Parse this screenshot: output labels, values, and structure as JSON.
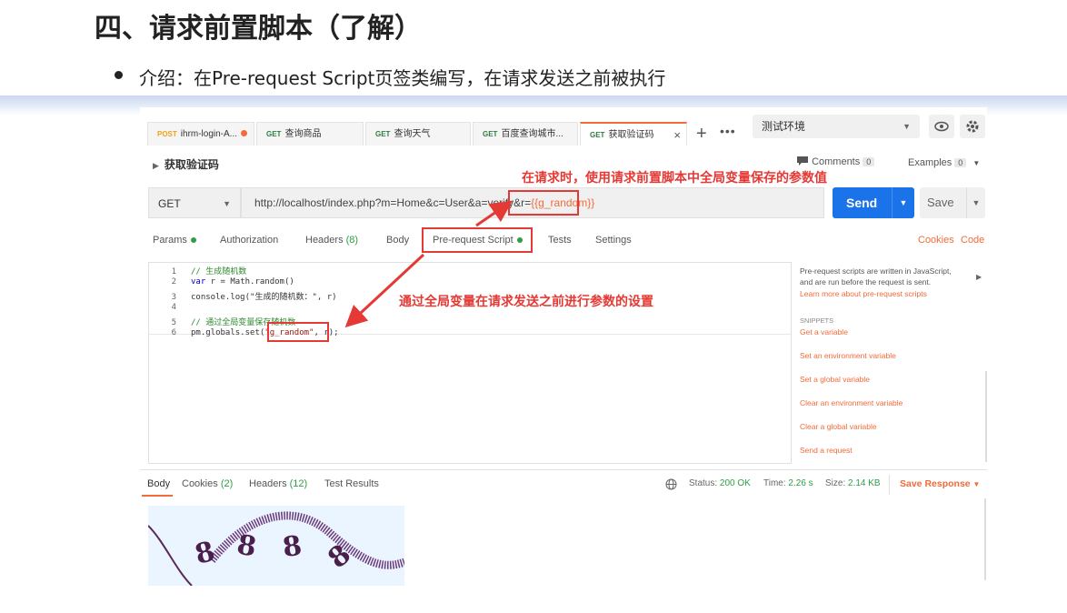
{
  "slide": {
    "title": "四、请求前置脚本（了解）",
    "bullet": "介绍：在Pre-request Script页签类编写，在请求发送之前被执行"
  },
  "tabs": [
    {
      "method": "POST",
      "label": "ihrm-login-A..."
    },
    {
      "method": "GET",
      "label": "查询商品"
    },
    {
      "method": "GET",
      "label": "查询天气"
    },
    {
      "method": "GET",
      "label": "百度查询城市..."
    },
    {
      "method": "GET",
      "label": "获取验证码"
    }
  ],
  "tab_close": "×",
  "tab_add": "+",
  "tab_more": "•••",
  "environment": {
    "selected": "测试环境"
  },
  "request": {
    "name": "获取验证码",
    "method": "GET",
    "url_prefix": "http://localhost/index.php?m=Home&c=User&a=verify&r=",
    "url_var": "{{g_random}}",
    "send_label": "Send",
    "save_label": "Save"
  },
  "comments": {
    "label": "Comments",
    "count": "0"
  },
  "examples": {
    "label": "Examples",
    "count": "0"
  },
  "request_tabs": {
    "params": "Params",
    "authorization": "Authorization",
    "headers": "Headers",
    "headers_count": "(8)",
    "body": "Body",
    "prerequest": "Pre-request Script",
    "tests": "Tests",
    "settings": "Settings",
    "cookies": "Cookies",
    "code": "Code"
  },
  "code_lines": [
    {
      "n": "1",
      "text": "// 生成随机数"
    },
    {
      "n": "2",
      "kw": "var",
      "text": " r = Math.random()"
    },
    {
      "n": "3",
      "text": "console.log(\"生成的随机数：\", r)"
    },
    {
      "n": "4",
      "text": ""
    },
    {
      "n": "5",
      "text": "// 通过全局变量保存随机数"
    },
    {
      "n": "6",
      "pre": "pm.globals.set(",
      "str": "\"g_random\"",
      "post": ", r);"
    }
  ],
  "sidebar": {
    "desc1": "Pre-request scripts are written in JavaScript,",
    "desc2": "and are run before the request is sent.",
    "learn": "Learn more about pre-request scripts",
    "snippets_title": "SNIPPETS",
    "snippets": [
      "Get a variable",
      "Set an environment variable",
      "Set a global variable",
      "Clear an environment variable",
      "Clear a global variable",
      "Send a request"
    ]
  },
  "response": {
    "tabs": {
      "body": "Body",
      "cookies": "Cookies",
      "cookies_count": "(2)",
      "headers": "Headers",
      "headers_count": "(12)",
      "tests": "Test Results"
    },
    "status_label": "Status:",
    "status": "200 OK",
    "time_label": "Time:",
    "time": "2.26 s",
    "size_label": "Size:",
    "size": "2.14 KB",
    "save_response": "Save Response",
    "captcha_digits": [
      "8",
      "8",
      "8",
      "8"
    ]
  },
  "annotations": {
    "top": "在请求时，使用请求前置脚本中全局变量保存的参数值",
    "middle": "通过全局变量在请求发送之前进行参数的设置"
  },
  "colors": {
    "accent": "#f26b3a",
    "send": "#1a73e8",
    "annotation": "#e53935",
    "get_method": "#2f7c43",
    "post_method": "#f0a21c"
  }
}
